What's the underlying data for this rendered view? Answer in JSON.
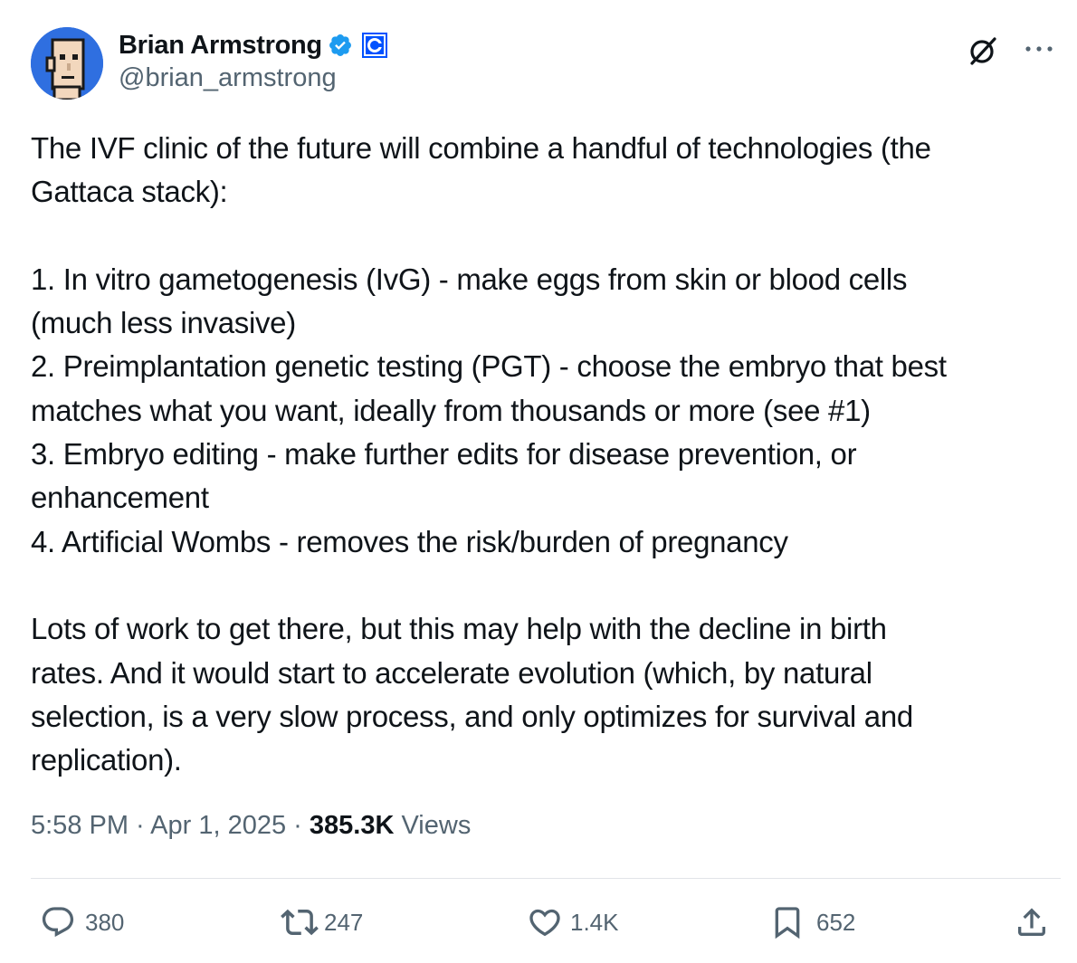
{
  "author": {
    "display_name": "Brian Armstrong",
    "handle": "@brian_armstrong",
    "avatar": "punk-pixel-avatar",
    "verified_icon": "verified-badge-icon",
    "affiliate_icon": "coinbase-affiliate-icon"
  },
  "header_icons": {
    "grok": "grok-icon",
    "more": "more-icon"
  },
  "tweet": {
    "lines": [
      "The IVF clinic of the future will combine a handful of technologies (the",
      "Gattaca stack):",
      "",
      "1. In vitro gametogenesis (IvG) - make eggs from skin or blood cells",
      "(much less invasive)",
      "2. Preimplantation genetic testing (PGT) - choose the embryo that best",
      "matches what you want, ideally from thousands or more (see #1)",
      "3. Embryo editing - make further edits for disease prevention, or",
      "enhancement",
      "4. Artificial Wombs - removes the risk/burden of pregnancy",
      "",
      "Lots of work to get there, but this may help with the decline in birth",
      "rates. And it would start to accelerate evolution (which, by natural",
      "selection, is a very slow process, and only optimizes for survival and",
      "replication)."
    ]
  },
  "meta": {
    "time": "5:58 PM",
    "separator": " · ",
    "date": "Apr 1, 2025",
    "views_count": "385.3K",
    "views_label": "Views"
  },
  "actions": {
    "replies": "380",
    "reposts": "247",
    "likes": "1.4K",
    "bookmarks": "652"
  },
  "colors": {
    "text": "#0f1419",
    "secondary": "#536471",
    "verified": "#1d9bf0",
    "coinbase": "#0052ff"
  }
}
